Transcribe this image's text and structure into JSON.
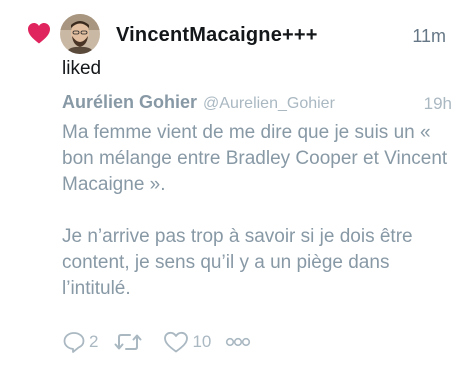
{
  "notification": {
    "type_icon": "heart-icon",
    "accent_color": "#e0245e",
    "actor": {
      "name": "VincentMacaigne+++",
      "avatar": "avatar"
    },
    "time": "11m",
    "action_label": "liked"
  },
  "quoted_tweet": {
    "author_name": "Aurélien Gohier",
    "author_handle": "@Aurelien_Gohier",
    "time": "19h",
    "paragraphs": [
      "Ma femme vient de me dire que je suis un « bon mélange entre Bradley Cooper et Vincent Macaigne ».",
      "Je n’arrive pas trop à savoir si je dois être content, je sens qu’il y a un piège dans l’intitulé."
    ],
    "actions": {
      "reply_count": "2",
      "retweet_count": "",
      "like_count": "10"
    }
  }
}
